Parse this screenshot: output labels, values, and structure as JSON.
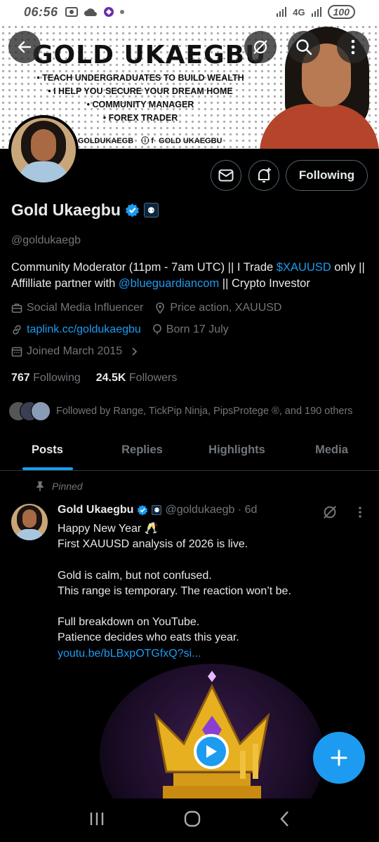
{
  "status_bar": {
    "time": "06:56",
    "network": "4G",
    "battery": "100"
  },
  "banner": {
    "title": "GOLD UKAEGBU",
    "bullets": [
      "• TEACH UNDERGRADUATES TO BUILD WEALTH",
      "• I HELP YOU SECURE YOUR DREAM HOME",
      "• COMMUNITY MANAGER",
      "• FOREX TRADER"
    ],
    "social_x": "@GOLDUKAEGB",
    "social_ig_fb": "GOLD UKAEGBU"
  },
  "profile": {
    "name": "Gold Ukaegbu",
    "handle": "@goldukaegb",
    "bio_part1": "Community Moderator (11pm - 7am UTC) || I Trade ",
    "bio_cashtag": "$XAUUSD",
    "bio_part2": " only || Affilliate partner with ",
    "bio_mention": "@blueguardiancom",
    "bio_part3": " || Crypto Investor",
    "category": "Social Media Influencer",
    "location": "Price action, XAUUSD",
    "website": "taplink.cc/goldukaegbu",
    "birthday": "Born 17 July",
    "joined": "Joined March 2015",
    "following_count": "767",
    "following_label": "Following",
    "followers_count": "24.5K",
    "followers_label": "Followers",
    "followed_by": "Followed by Range, TickPip Ninja, PipsProtege ®, and 190 others"
  },
  "buttons": {
    "following": "Following"
  },
  "tabs": [
    {
      "label": "Posts",
      "active": true
    },
    {
      "label": "Replies",
      "active": false
    },
    {
      "label": "Highlights",
      "active": false
    },
    {
      "label": "Media",
      "active": false
    }
  ],
  "post": {
    "pinned_label": "Pinned",
    "author": "Gold Ukaegbu",
    "handle_time": "@goldukaegb · 6d",
    "lines": {
      "l1": "Happy New Year 🥂",
      "l2": "First XAUUSD analysis of 2026 is live.",
      "l3": "Gold is calm, but not confused.",
      "l4": "This range is temporary. The reaction won’t be.",
      "l5": "Full breakdown on YouTube.",
      "l6": "Patience decides who eats this year.",
      "link": "youtu.be/bLBxpOTGfxQ?si..."
    }
  },
  "colors": {
    "accent": "#1d9bf0",
    "text": "#e7e9ea",
    "muted": "#71767b",
    "border": "#2f3336"
  }
}
